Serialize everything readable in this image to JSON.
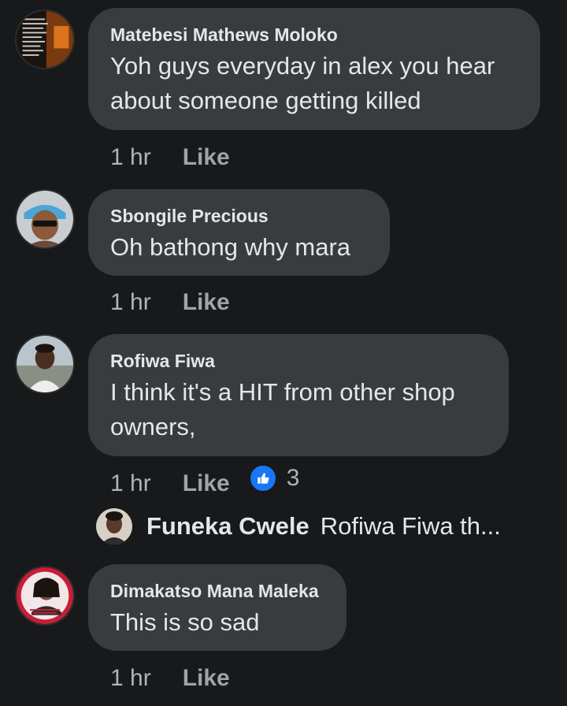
{
  "comments": [
    {
      "name": "Matebesi Mathews Moloko",
      "text_lines": [
        "Yoh guys everyday in alex you hear",
        "about someone getting killed"
      ],
      "time": "1 hr",
      "like_label": "Like"
    },
    {
      "name": "Sbongile Precious",
      "text_lines": [
        "Oh bathong why mara"
      ],
      "time": "1 hr",
      "like_label": "Like"
    },
    {
      "name": "Rofiwa Fiwa",
      "text_lines": [
        "I think it's a HIT from other shop",
        "owners,"
      ],
      "time": "1 hr",
      "like_label": "Like",
      "reaction_count": "3"
    },
    {
      "name": "Dimakatso Mana Maleka",
      "text_lines": [
        "This is so sad"
      ],
      "time": "1 hr",
      "like_label": "Like"
    }
  ],
  "reply": {
    "name": "Funeka Cwele",
    "text": "Rofiwa Fiwa th..."
  },
  "colors": {
    "background": "#18191a",
    "bubble": "#3a3b3c",
    "like_blue": "#1877f2"
  },
  "icons": [
    "like-reaction-icon"
  ]
}
